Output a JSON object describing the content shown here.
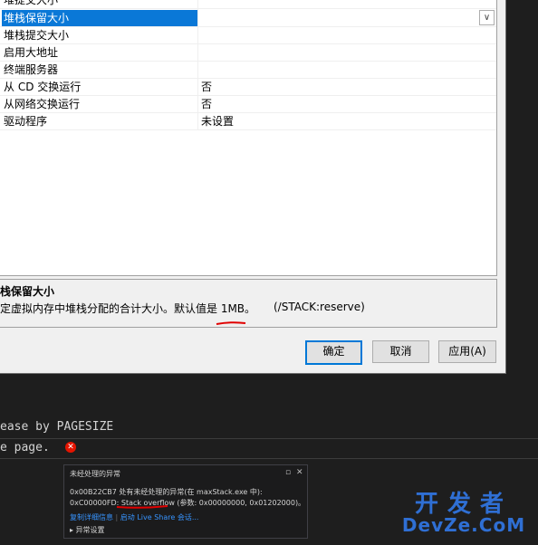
{
  "property_grid": {
    "rows": [
      {
        "name": "堆提交大小",
        "value": ""
      },
      {
        "name": "堆栈保留大小",
        "value": ""
      },
      {
        "name": "堆栈提交大小",
        "value": ""
      },
      {
        "name": "启用大地址",
        "value": ""
      },
      {
        "name": "终端服务器",
        "value": ""
      },
      {
        "name": "从 CD 交换运行",
        "value": "否"
      },
      {
        "name": "从网络交换运行",
        "value": "否"
      },
      {
        "name": "驱动程序",
        "value": "未设置"
      }
    ],
    "dropdown_icon": "chevron-down-icon"
  },
  "description": {
    "title": "栈保留大小",
    "text": "定虚拟内存中堆栈分配的合计大小。默认值是 1MB。",
    "switch": "(/STACK:reserve)"
  },
  "buttons": {
    "ok": "确定",
    "cancel": "取消",
    "apply": "应用(A)"
  },
  "editor": {
    "line1": "ease by PAGESIZE",
    "line2": "e page."
  },
  "exception_popup": {
    "title": "未经处理的异常",
    "pin_icon": "pin-icon",
    "close_icon": "close-icon",
    "line1": "0x00B22CB7 处有未经处理的异常(在 maxStack.exe 中):",
    "line2": "0xC00000FD: Stack overflow (参数: 0x00000000, 0x01202000)。",
    "copy_details": "复制详细信息",
    "live_share": "启动 Live Share 会话...",
    "settings": "异常设置"
  },
  "watermark": {
    "top": "开发者",
    "bottom": "DevZe.CoM"
  },
  "colors": {
    "selection": "#0a78d7",
    "error": "#e51400",
    "link": "#3794ff",
    "watermark": "#2f6fd4"
  }
}
